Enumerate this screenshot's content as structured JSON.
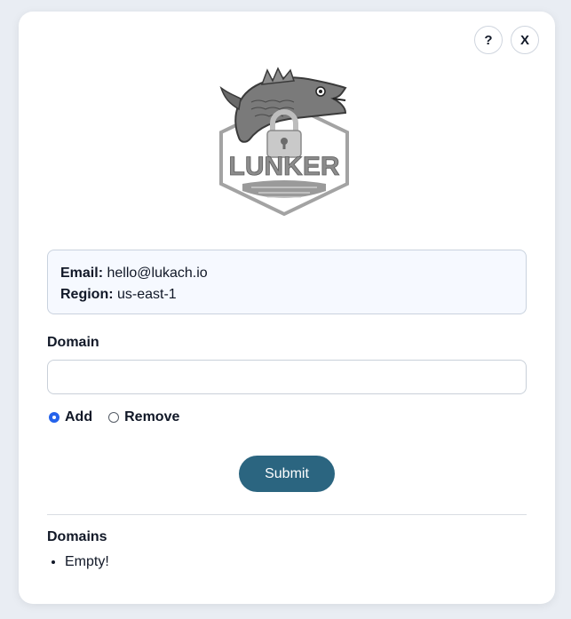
{
  "header": {
    "help_label": "?",
    "close_label": "X"
  },
  "logo": {
    "text": "LUNKER",
    "icon": "fish-lock-logo"
  },
  "account": {
    "email_label": "Email:",
    "email_value": "hello@lukach.io",
    "region_label": "Region:",
    "region_value": "us-east-1"
  },
  "form": {
    "domain_label": "Domain",
    "domain_value": "",
    "domain_placeholder": "",
    "options": [
      {
        "label": "Add",
        "selected": true
      },
      {
        "label": "Remove",
        "selected": false
      }
    ],
    "submit_label": "Submit"
  },
  "domains": {
    "title": "Domains",
    "items": [
      "Empty!"
    ]
  },
  "colors": {
    "accent": "#2563eb",
    "submit": "#2b6580",
    "info_bg": "#f6f9ff"
  }
}
